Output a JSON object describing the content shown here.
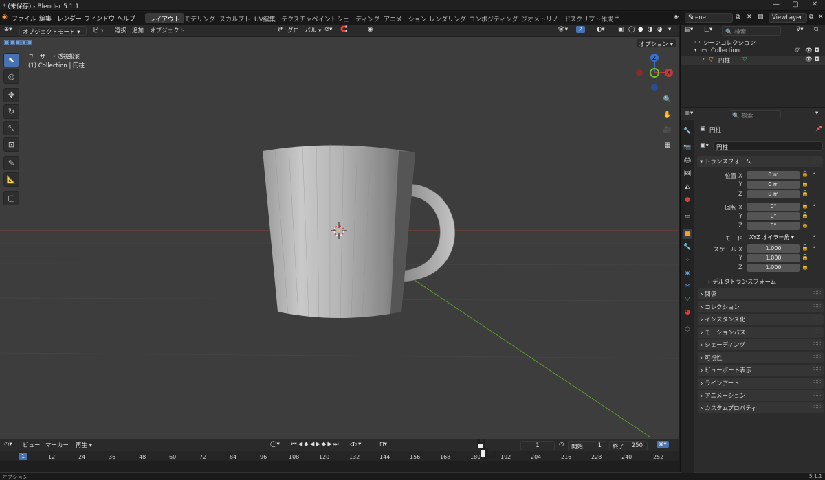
{
  "window": {
    "title": "* (未保存) - Blender 5.1.1",
    "version": "5.1.1"
  },
  "menu": [
    "ファイル",
    "編集",
    "レンダー",
    "ウィンドウ",
    "ヘルプ"
  ],
  "workspaces": [
    "レイアウト",
    "モデリング",
    "スカルプト",
    "UV編集",
    "テクスチャペイント",
    "シェーディング",
    "アニメーション",
    "レンダリング",
    "コンポジティング",
    "ジオメトリノード",
    "スクリプト作成",
    "+"
  ],
  "scene": {
    "name": "Scene",
    "view_layer": "ViewLayer"
  },
  "viewport_header": {
    "mode": "オブジェクトモード",
    "view": "ビュー",
    "select": "選択",
    "add": "追加",
    "object": "オブジェクト",
    "transform_orientation": "グローバル"
  },
  "viewport": {
    "line1": "ユーザー・透視投影",
    "line2": "(1) Collection | 円柱",
    "options": "オプション",
    "gizmo": {
      "z": "Z",
      "y": "Y",
      "x": "X"
    },
    "colors": {
      "bg": "#3d3d3d",
      "x_axis": "#c0393b",
      "y_axis": "#6fbf2e",
      "z_axis": "#3a70c8",
      "mug_light": "#c8c8c8",
      "mug_dark": "#6e6e6e"
    }
  },
  "timeline": {
    "view": "ビュー",
    "marker": "マーカー",
    "playback": "再生",
    "current_frame": "1",
    "start_label": "開始",
    "start": "1",
    "end_label": "終了",
    "end": "250",
    "ticks": [
      "1",
      "12",
      "24",
      "36",
      "48",
      "60",
      "72",
      "84",
      "96",
      "108",
      "120",
      "132",
      "144",
      "156",
      "168",
      "180",
      "192",
      "204",
      "216",
      "228",
      "240",
      "252"
    ]
  },
  "statusbar": {
    "left": "オプション",
    "right": "5.1.1"
  },
  "outliner": {
    "search_placeholder": "検索",
    "scene_collection": "シーンコレクション",
    "collection": "Collection",
    "object": "円柱"
  },
  "properties": {
    "search_placeholder": "検索",
    "object_name": "円柱",
    "data_name": "円柱",
    "transform_title": "トランスフォーム",
    "location_label": "位置 X",
    "loc_x": "0 m",
    "loc_y": "0 m",
    "loc_z": "0 m",
    "rotation_label": "回転 X",
    "rot_x": "0°",
    "rot_y": "0°",
    "rot_z": "0°",
    "mode_label": "モード",
    "mode_value": "XYZ オイラー角",
    "scale_label": "スケール X",
    "scale_x": "1.000",
    "scale_y": "1.000",
    "scale_z": "1.000",
    "y_label": "Y",
    "z_label": "Z",
    "delta": "デルタトランスフォーム",
    "panels": [
      "関係",
      "コレクション",
      "インスタンス化",
      "モーションパス",
      "シェーディング",
      "可視性",
      "ビューポート表示",
      "ラインアート",
      "アニメーション",
      "カスタムプロパティ"
    ]
  }
}
